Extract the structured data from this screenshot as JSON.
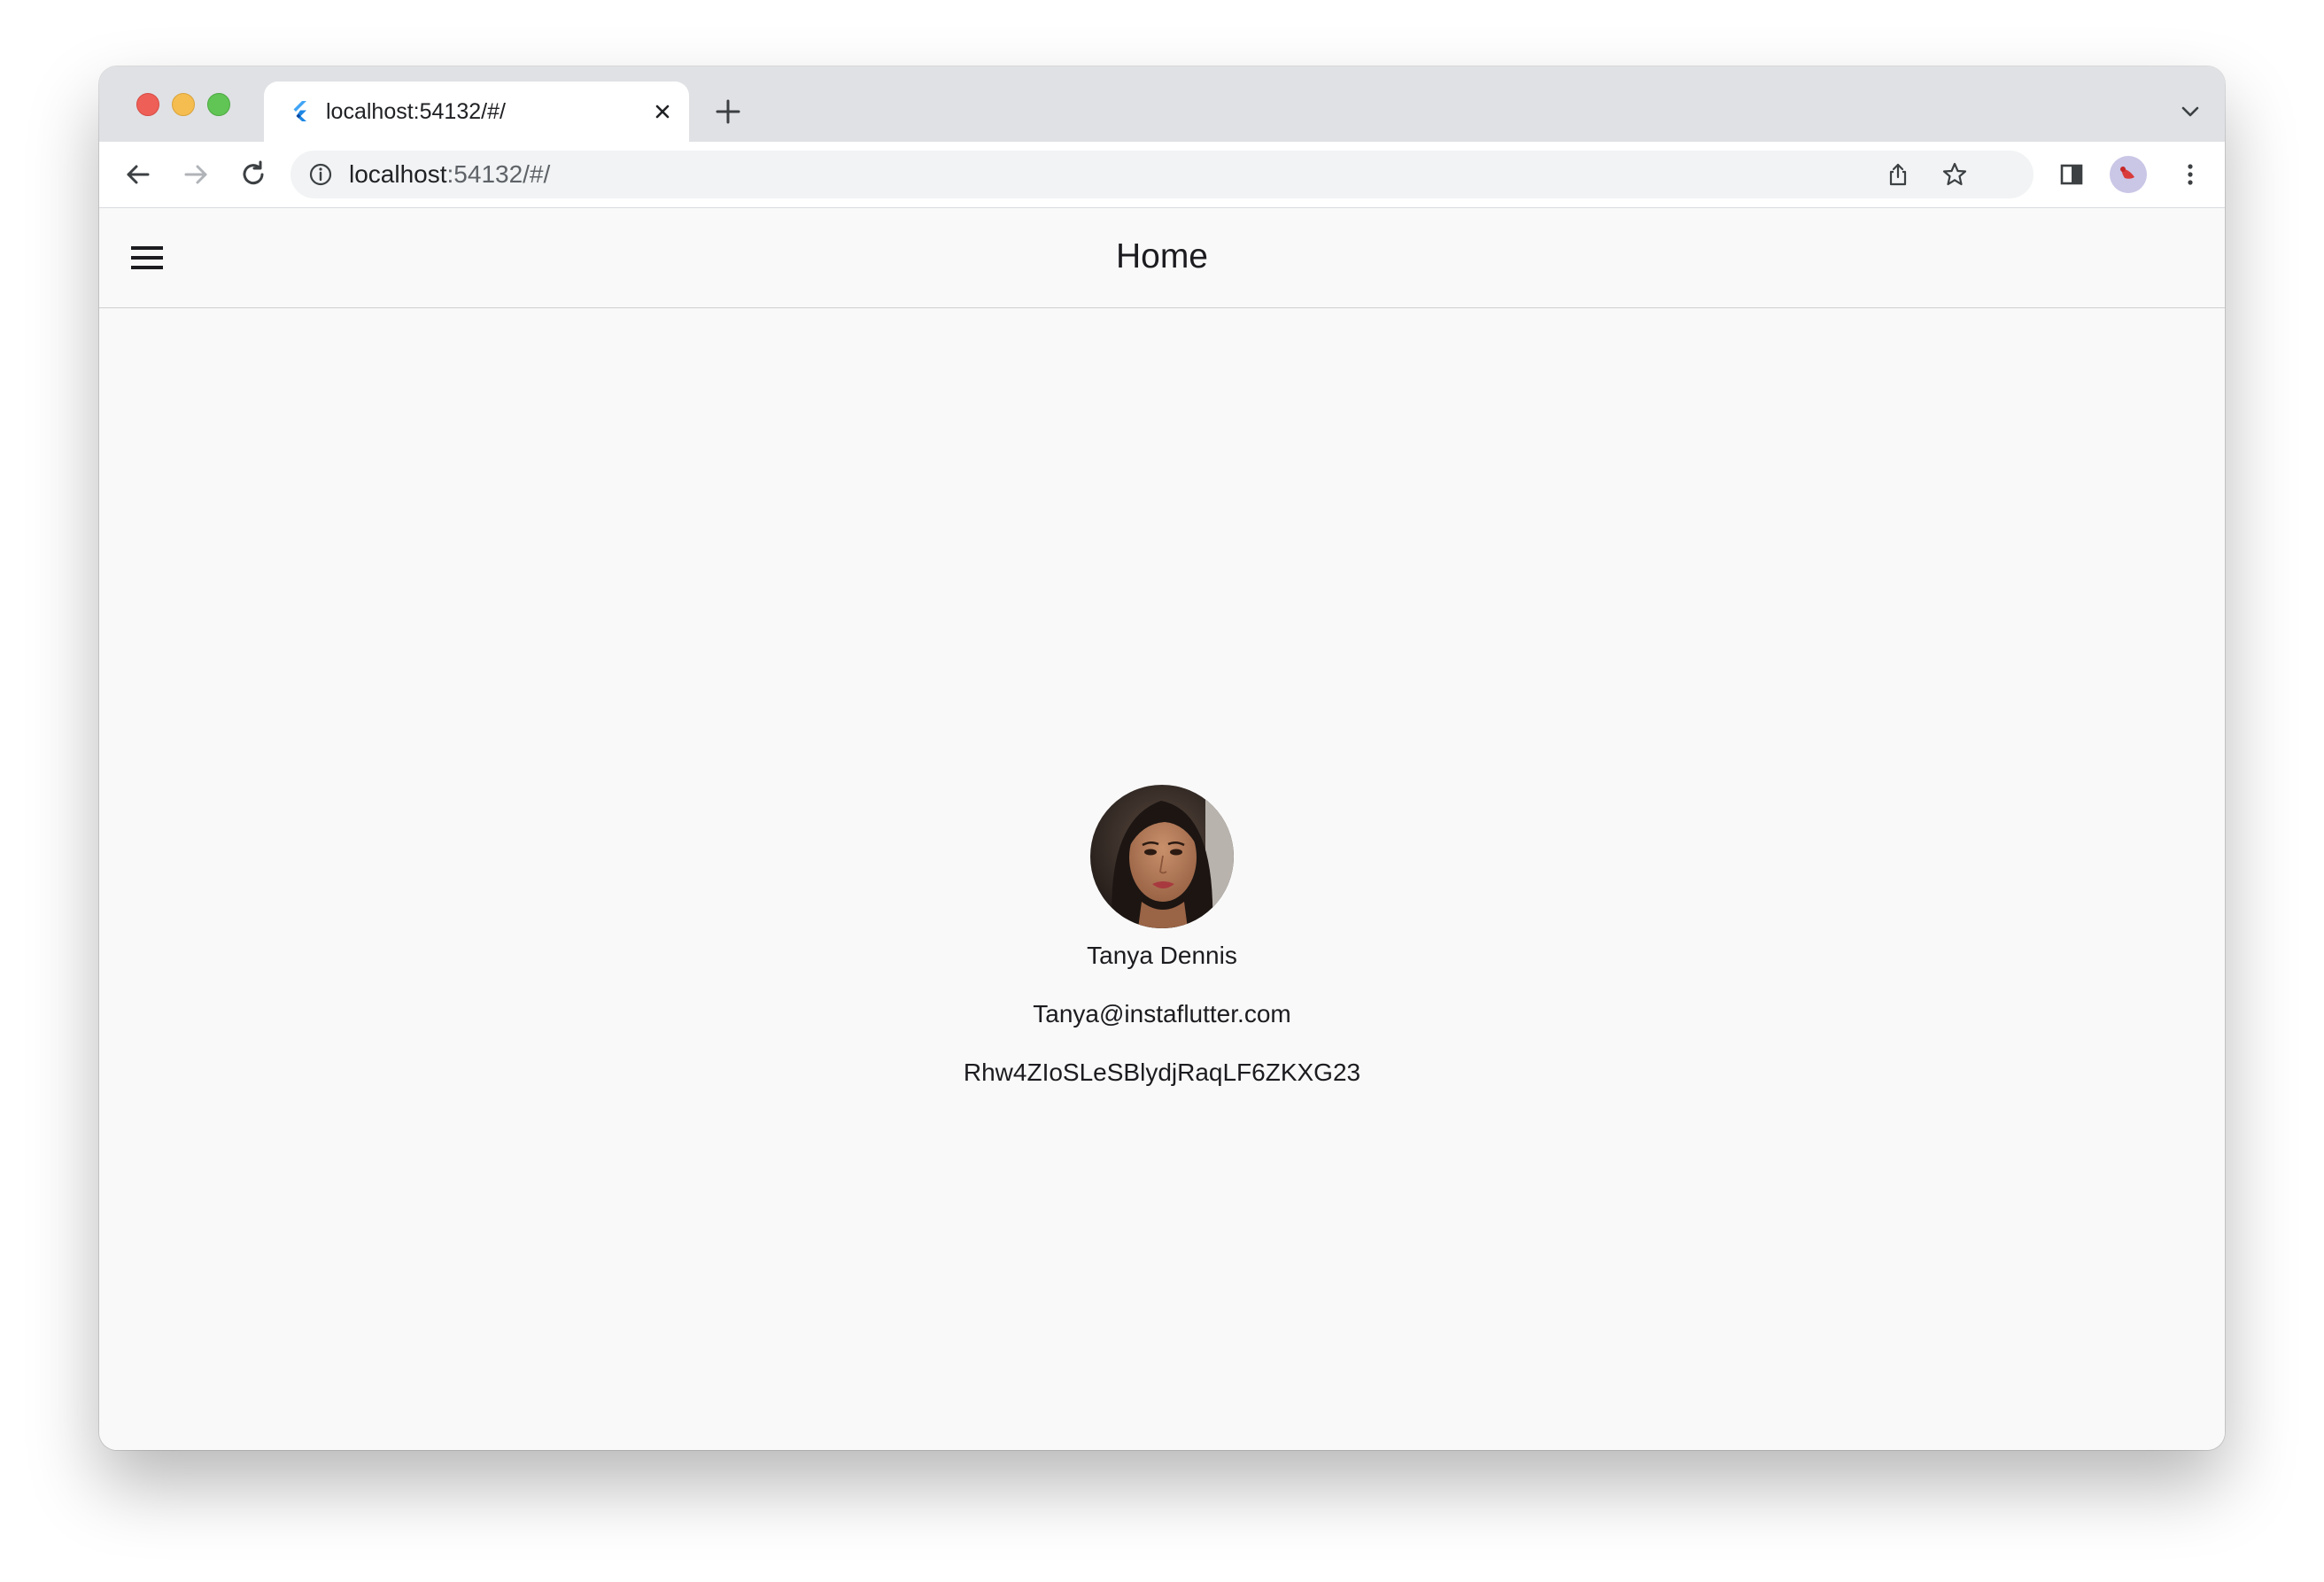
{
  "browser": {
    "tab": {
      "title": "localhost:54132/#/"
    },
    "address_bar": {
      "host": "localhost",
      "path": ":54132/#/"
    },
    "icons": {
      "back": "back-arrow-icon",
      "forward": "forward-arrow-icon",
      "reload": "reload-icon",
      "info": "info-icon",
      "share": "share-icon",
      "bookmark": "star-icon",
      "side_panel": "side-panel-icon",
      "profile": "avatar",
      "menu": "kebab-menu-icon"
    }
  },
  "app": {
    "appbar": {
      "title": "Home",
      "menu_icon": "hamburger-menu-icon"
    },
    "profile": {
      "name": "Tanya Dennis",
      "email": "Tanya@instaflutter.com",
      "user_id": "Rhw4ZIoSLeSBlydjRaqLF6ZKXG23"
    }
  },
  "colors": {
    "tabstrip": "#dfe1e5",
    "page_background": "#f9f9f9",
    "text": "#1c1b1f"
  }
}
